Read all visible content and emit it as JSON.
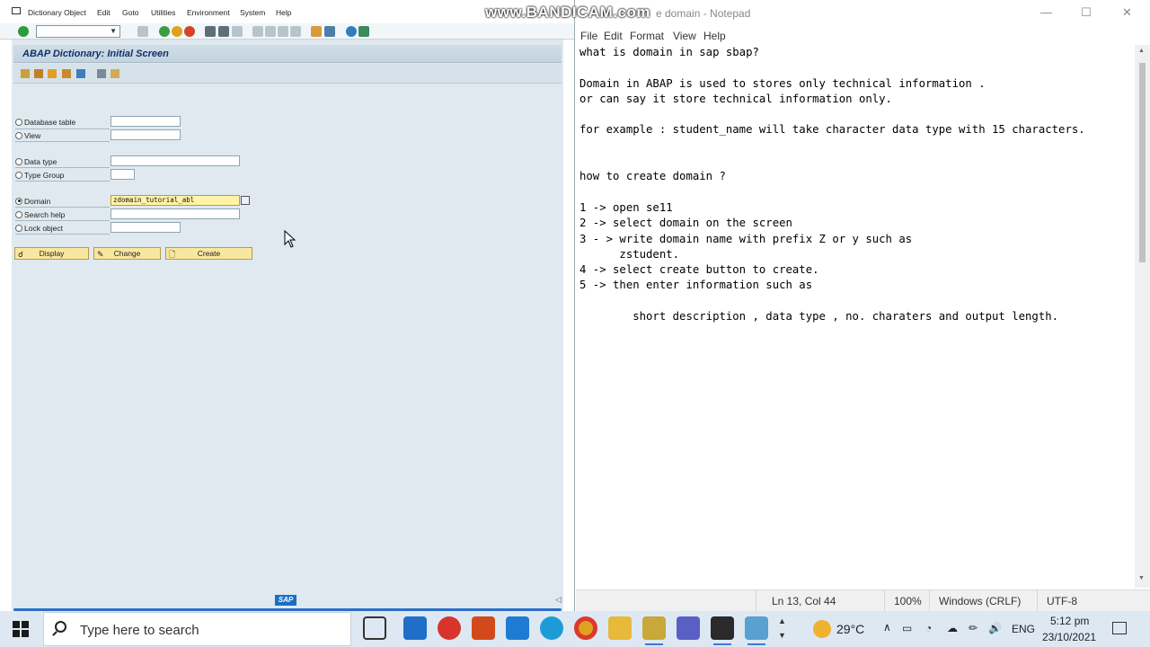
{
  "watermark": "www.BANDICAM.com",
  "sap": {
    "menus": [
      "Dictionary Object",
      "Edit",
      "Goto",
      "Utilities",
      "Environment",
      "System",
      "Help"
    ],
    "screen_title": "ABAP Dictionary: Initial Screen",
    "options": [
      {
        "label": "Database table",
        "selected": false,
        "value": ""
      },
      {
        "label": "View",
        "selected": false,
        "value": ""
      },
      {
        "label": "Data type",
        "selected": false,
        "value": ""
      },
      {
        "label": "Type Group",
        "selected": false,
        "value": ""
      },
      {
        "label": "Domain",
        "selected": true,
        "value": "zdomain_tutorial_abl"
      },
      {
        "label": "Search help",
        "selected": false,
        "value": ""
      },
      {
        "label": "Lock object",
        "selected": false,
        "value": ""
      }
    ],
    "buttons": {
      "display": "Display",
      "change": "Change",
      "create": "Create"
    },
    "logo": "SAP"
  },
  "notepad": {
    "title": "e domain - Notepad",
    "menus": [
      "File",
      "Edit",
      "Format",
      "View",
      "Help"
    ],
    "content": "what is domain in sap sbap?\n\nDomain in ABAP is used to stores only technical information .\nor can say it store technical information only.\n\nfor example : student_name will take character data type with 15 characters.\n\n\nhow to create domain ?\n\n1 -> open se11\n2 -> select domain on the screen\n3 - > write domain name with prefix Z or y such as\n      zstudent.\n4 -> select create button to create.\n5 -> then enter information such as\n\n        short description , data type , no. charaters and output length.",
    "status": {
      "position": "Ln 13, Col 44",
      "zoom": "100%",
      "line_endings": "Windows (CRLF)",
      "encoding": "UTF-8"
    }
  },
  "taskbar": {
    "search_placeholder": "Type here to search",
    "weather": "29°C",
    "language": "ENG",
    "time": "5:12 pm",
    "date": "23/10/2021"
  }
}
